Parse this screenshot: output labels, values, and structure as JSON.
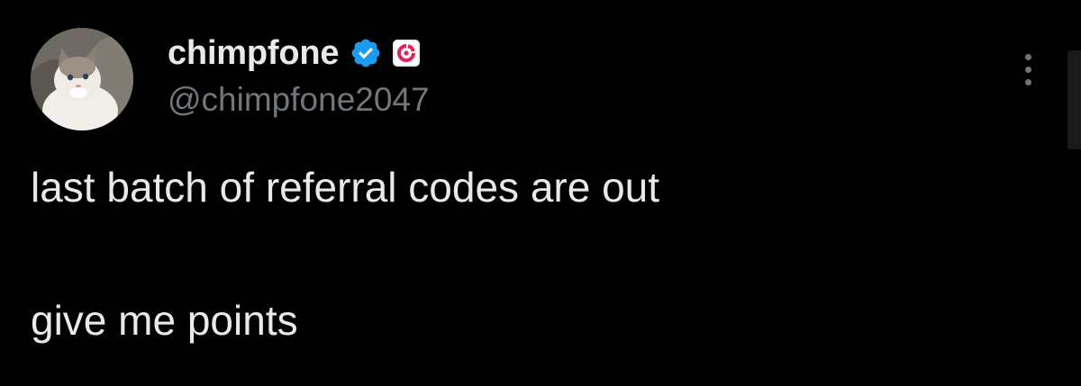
{
  "author": {
    "display_name": "chimpfone",
    "handle": "@chimpfone2047",
    "verified": true,
    "verified_icon": "verified-checkmark-icon",
    "affiliate_icon": "affiliate-logo-icon"
  },
  "menu": {
    "icon": "more-vertical-icon"
  },
  "tweet": {
    "lines": [
      "last batch of referral codes are out",
      "give me points"
    ]
  },
  "colors": {
    "background": "#000000",
    "primary_text": "#e7e9ea",
    "secondary_text": "#71767b",
    "verified_blue": "#1d9bf0",
    "affiliate_red": "#e0245e"
  }
}
